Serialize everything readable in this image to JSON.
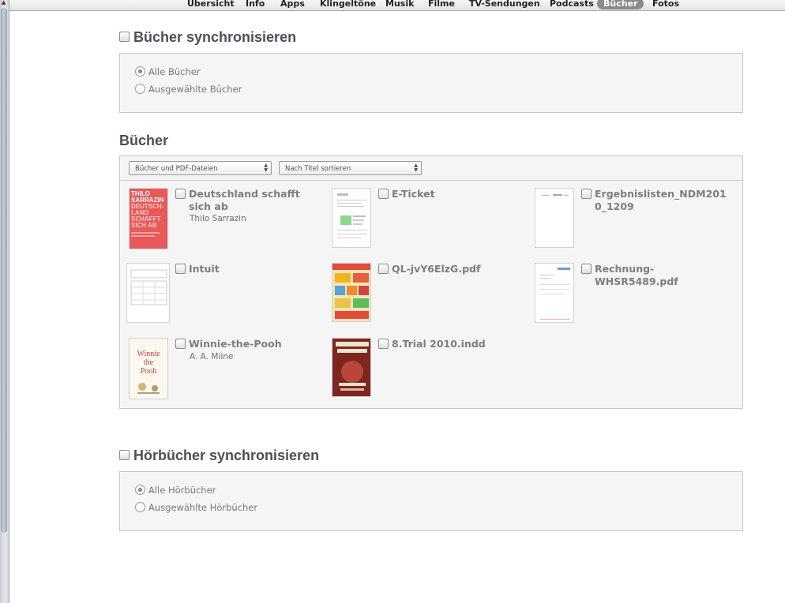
{
  "tabs": [
    {
      "label": "Übersicht",
      "active": false
    },
    {
      "label": "Info",
      "active": false
    },
    {
      "label": "Apps",
      "active": false
    },
    {
      "label": "Klingeltöne",
      "active": false
    },
    {
      "label": "Musik",
      "active": false
    },
    {
      "label": "Filme",
      "active": false
    },
    {
      "label": "TV-Sendungen",
      "active": false
    },
    {
      "label": "Podcasts",
      "active": false
    },
    {
      "label": "Bücher",
      "active": true
    },
    {
      "label": "Fotos",
      "active": false
    }
  ],
  "books_sync": {
    "title": "Bücher synchronisieren",
    "options": [
      {
        "label": "Alle Bücher",
        "selected": true
      },
      {
        "label": "Ausgewählte Bücher",
        "selected": false
      }
    ]
  },
  "books": {
    "heading": "Bücher",
    "filter_select": "Bücher und PDF-Dateien",
    "sort_select": "Nach Titel sortieren",
    "items": [
      {
        "title": "Deutschland schafft sich ab",
        "author": "Thilo Sarrazin",
        "cover": "sarrazin",
        "cover_text": [
          "THILO",
          "SARRAZIN",
          "DEUTSCH-",
          "LAND",
          "SCHAFFT",
          "SICH AB"
        ]
      },
      {
        "title": "E-Ticket",
        "author": "",
        "cover": "ticket"
      },
      {
        "title": "Ergebnislisten_NDM2010_1209",
        "author": "",
        "cover": "doc-blank"
      },
      {
        "title": "Intuit",
        "author": "",
        "cover": "form"
      },
      {
        "title": "QL-jvY6ElzG.pdf",
        "author": "",
        "cover": "flyer"
      },
      {
        "title": "Rechnung-WHSR5489.pdf",
        "author": "",
        "cover": "invoice"
      },
      {
        "title": "Winnie-the-Pooh",
        "author": "A. A. Milne",
        "cover": "pooh",
        "cover_text": [
          "Winnie",
          "the",
          "Pooh"
        ]
      },
      {
        "title": "8.Trial 2010.indd",
        "author": "",
        "cover": "poster"
      }
    ]
  },
  "audiobooks_sync": {
    "title": "Hörbücher synchronisieren",
    "options": [
      {
        "label": "Alle Hörbücher",
        "selected": true
      },
      {
        "label": "Ausgewählte Hörbücher",
        "selected": false
      }
    ]
  }
}
